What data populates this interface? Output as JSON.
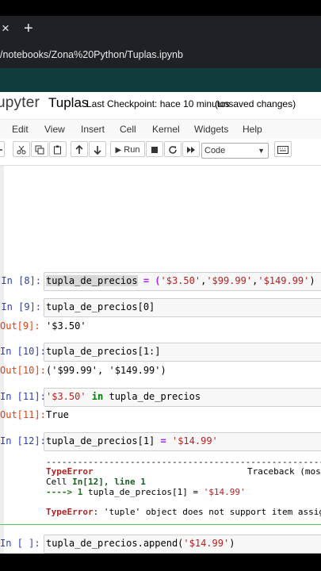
{
  "browser": {
    "tab_close": "×",
    "new_tab": "+",
    "url": "/notebooks/Zona%20Python/Tuplas.ipynb"
  },
  "header": {
    "logo": "upyter",
    "notebook_name": "Tuplas",
    "checkpoint": "Last Checkpoint: hace 10 minutos",
    "unsaved": "(unsaved changes)"
  },
  "menu": [
    "Edit",
    "View",
    "Insert",
    "Cell",
    "Kernel",
    "Widgets",
    "Help"
  ],
  "toolbar": {
    "run_label": "Run",
    "cell_type": "Code",
    "icons": [
      "add-cell-icon",
      "cut-icon",
      "copy-icon",
      "paste-icon",
      "move-up-icon",
      "move-down-icon",
      "run-icon",
      "stop-icon",
      "restart-icon",
      "fast-forward-icon",
      "keyboard-icon"
    ]
  },
  "cells": [
    {
      "in_prompt": "In [8]:",
      "code_a": "tupla_de_precios",
      "code_b": " = (",
      "code_c": "'$3.50'",
      "code_d": ",",
      "code_e": "'$99.99'",
      "code_f": ",",
      "code_g": "'$149.99'",
      "code_h": ")"
    },
    {
      "in_prompt": "In [9]:",
      "code": "tupla_de_precios[0]",
      "out_prompt": "Out[9]:",
      "output": "'$3.50'"
    },
    {
      "in_prompt": "In [10]:",
      "code": "tupla_de_precios[1:]",
      "out_prompt": "Out[10]:",
      "output": "('$99.99', '$149.99')"
    },
    {
      "in_prompt": "In [11]:",
      "code_a": "'$3.50'",
      "code_b": " in ",
      "code_c": "tupla_de_precios",
      "out_prompt": "Out[11]:",
      "output": "True"
    },
    {
      "in_prompt": "In [12]:",
      "code_a": "tupla_de_precios[1] ",
      "code_b": "=",
      "code_c": " ",
      "code_d": "'$14.99'"
    },
    {
      "in_prompt": "In [ ]:",
      "code_a": "tupla_de_precios.append(",
      "code_b": "'$14.99'",
      "code_c": ")"
    }
  ],
  "error": {
    "dashes": "-------------------------------------------------------------------------",
    "type": "TypeError",
    "traceback": "Traceback (most",
    "cell_line_a": "Cell ",
    "cell_line_b": "In[12], line 1",
    "arrow": "----> 1",
    "arrow_code_a": " tupla_de_precios[1] = ",
    "arrow_code_b": "'$14.99'",
    "msg_type": "TypeError",
    "msg": ": 'tuple' object does not support item assignment"
  }
}
